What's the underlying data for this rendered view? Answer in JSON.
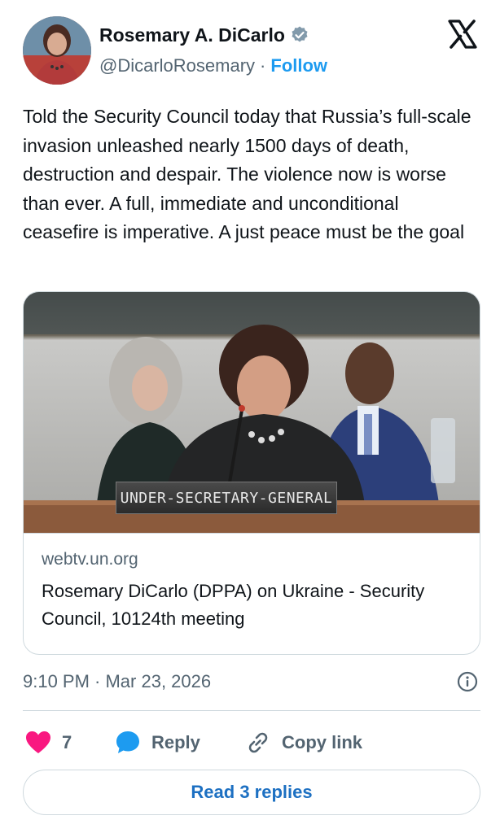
{
  "author": {
    "display_name": "Rosemary A. DiCarlo",
    "handle": "@DicarloRosemary",
    "separator": "·",
    "follow_label": "Follow",
    "avatar_icon": "profile-photo",
    "verified_icon": "verified-badge-icon"
  },
  "tweet": {
    "text": "Told the Security Council today that Russia’s full-scale invasion unleashed nearly 1500 days of death, destruction and despair. The violence now is worse than ever. A full, immediate and unconditional ceasefire is imperative. A just peace must be the goal"
  },
  "link_card": {
    "image_caption": "UNDER-SECRETARY-GENERAL",
    "domain": "webtv.un.org",
    "title": "Rosemary DiCarlo (DPPA) on Ukraine - Security Council, 10124th meeting"
  },
  "meta": {
    "timestamp": "9:10 PM · Mar 23, 2026"
  },
  "actions": {
    "like_count": "7",
    "reply_label": "Reply",
    "copy_link_label": "Copy link",
    "read_replies_label": "Read 3 replies"
  },
  "colors": {
    "accent": "#1d9bf0",
    "like": "#f91880",
    "text_secondary": "#536471",
    "border": "#cfd9de"
  }
}
